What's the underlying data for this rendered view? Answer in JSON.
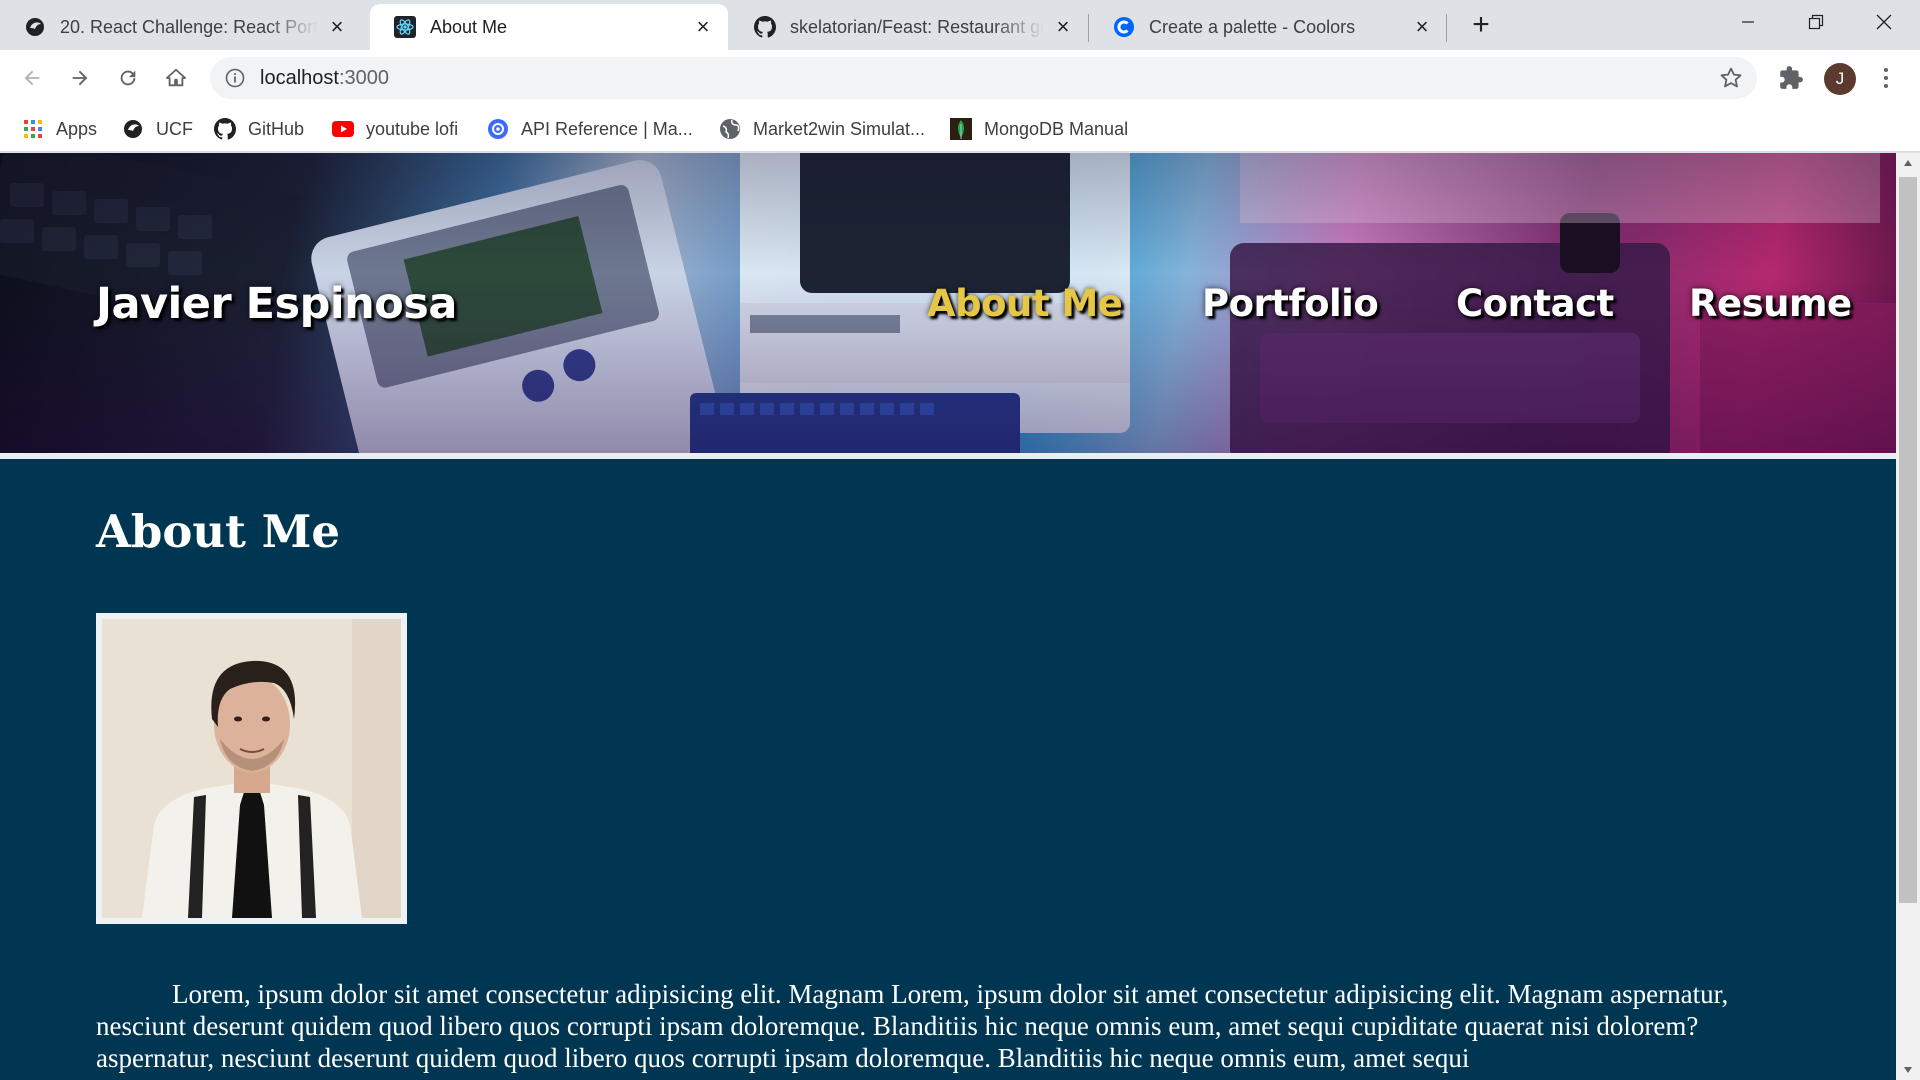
{
  "browser": {
    "tabs": [
      {
        "title": "20. React Challenge: React Portfo",
        "icon": "ucf-pegasus-icon",
        "active": false
      },
      {
        "title": "About Me",
        "icon": "react-atom-icon",
        "active": true
      },
      {
        "title": "skelatorian/Feast: Restaurant gen",
        "icon": "github-icon",
        "active": false
      },
      {
        "title": "Create a palette - Coolors",
        "icon": "coolors-icon",
        "active": false
      }
    ],
    "address": {
      "host": "localhost",
      "port": ":3000"
    },
    "profile_initial": "J",
    "bookmarks": [
      {
        "label": "Apps",
        "icon": "apps-grid-icon"
      },
      {
        "label": "UCF",
        "icon": "ucf-pegasus-icon"
      },
      {
        "label": "GitHub",
        "icon": "github-icon"
      },
      {
        "label": "youtube lofi",
        "icon": "youtube-icon"
      },
      {
        "label": "API Reference | Ma...",
        "icon": "api-reference-icon"
      },
      {
        "label": "Market2win Simulat...",
        "icon": "globe-icon"
      },
      {
        "label": "MongoDB Manual",
        "icon": "mongodb-leaf-icon"
      }
    ]
  },
  "site": {
    "brand": "Javier Espinosa",
    "nav": [
      {
        "label": "About Me",
        "current": true
      },
      {
        "label": "Portfolio",
        "current": false
      },
      {
        "label": "Contact",
        "current": false
      },
      {
        "label": "Resume",
        "current": false
      }
    ],
    "heading": "About Me",
    "bio": "Lorem, ipsum dolor sit amet consectetur adipisicing elit. Magnam Lorem, ipsum dolor sit amet consectetur adipisicing elit. Magnam aspernatur, nesciunt deserunt quidem quod libero quos corrupti ipsam doloremque. Blanditiis hic neque omnis eum, amet sequi cupiditate quaerat nisi dolorem? aspernatur, nesciunt deserunt quidem quod libero quos corrupti ipsam doloremque. Blanditiis hic neque omnis eum, amet sequi"
  },
  "colors": {
    "page_background": "#003651",
    "nav_current": "#e6c646",
    "nav_text": "#ffffff",
    "tabstrip": "#dee1e6"
  }
}
